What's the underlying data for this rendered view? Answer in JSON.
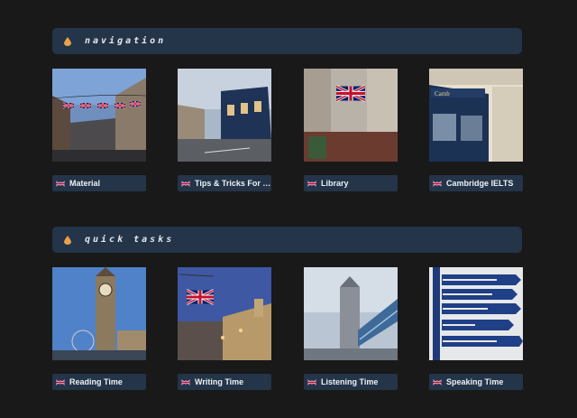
{
  "sections": [
    {
      "title": "navigation",
      "cards": [
        {
          "label": "Material",
          "scene": "street-flags-icon"
        },
        {
          "label": "Tips & Tricks For Y...",
          "scene": "pub-corner-icon"
        },
        {
          "label": "Library",
          "scene": "big-union-flag-icon"
        },
        {
          "label": "Cambridge IELTS",
          "scene": "bookshop-front-icon"
        }
      ]
    },
    {
      "title": "quick tasks",
      "cards": [
        {
          "label": "Reading Time",
          "scene": "big-ben-icon"
        },
        {
          "label": "Writing Time",
          "scene": "flag-dusk-icon"
        },
        {
          "label": "Listening Time",
          "scene": "tower-bridge-icon"
        },
        {
          "label": "Speaking Time",
          "scene": "signpost-icon"
        }
      ]
    }
  ],
  "colors": {
    "background": "#191919",
    "header": "#243449",
    "label": "#243449",
    "text": "#eef1f5"
  }
}
